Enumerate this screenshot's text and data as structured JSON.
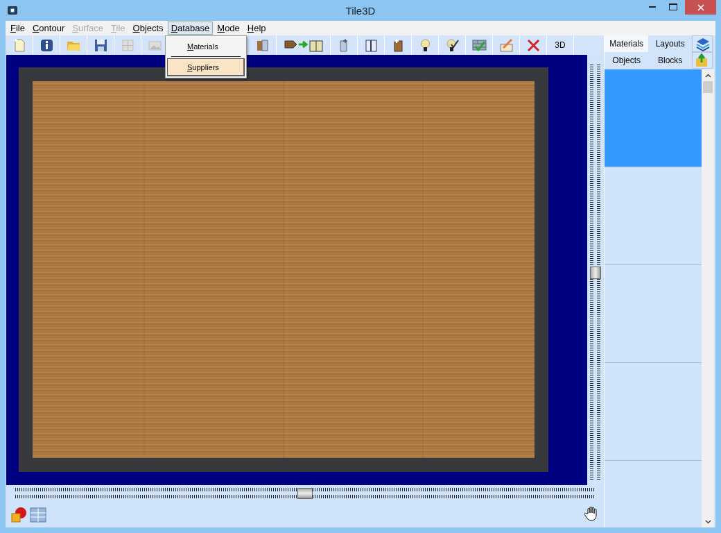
{
  "window": {
    "title": "Tile3D"
  },
  "menu": [
    {
      "label": "File",
      "disabled": false,
      "selected": false
    },
    {
      "label": "Contour",
      "disabled": false,
      "selected": false
    },
    {
      "label": "Surface",
      "disabled": true,
      "selected": false
    },
    {
      "label": "Tile",
      "disabled": true,
      "selected": false
    },
    {
      "label": "Objects",
      "disabled": false,
      "selected": false
    },
    {
      "label": "Database",
      "disabled": false,
      "selected": true
    },
    {
      "label": "Mode",
      "disabled": false,
      "selected": false
    },
    {
      "label": "Help",
      "disabled": false,
      "selected": false
    }
  ],
  "dropdown": {
    "items": [
      {
        "label": "Materials",
        "selected": false
      },
      {
        "label": "Suppliers",
        "selected": true
      }
    ]
  },
  "toolbar": {
    "view_button": "3D"
  },
  "view": {
    "vertical_slider": {
      "level": 0.5
    },
    "horizontal_slider": {
      "level": 0.5
    }
  },
  "panel": {
    "tabs": [
      {
        "label": "Materials",
        "selected": true
      },
      {
        "label": "Layouts",
        "selected": false
      },
      {
        "label": "Objects",
        "selected": false
      },
      {
        "label": "Blocks",
        "selected": false
      }
    ],
    "list": [
      {
        "selected": true
      },
      {
        "selected": false
      },
      {
        "selected": false
      },
      {
        "selected": false
      }
    ]
  }
}
